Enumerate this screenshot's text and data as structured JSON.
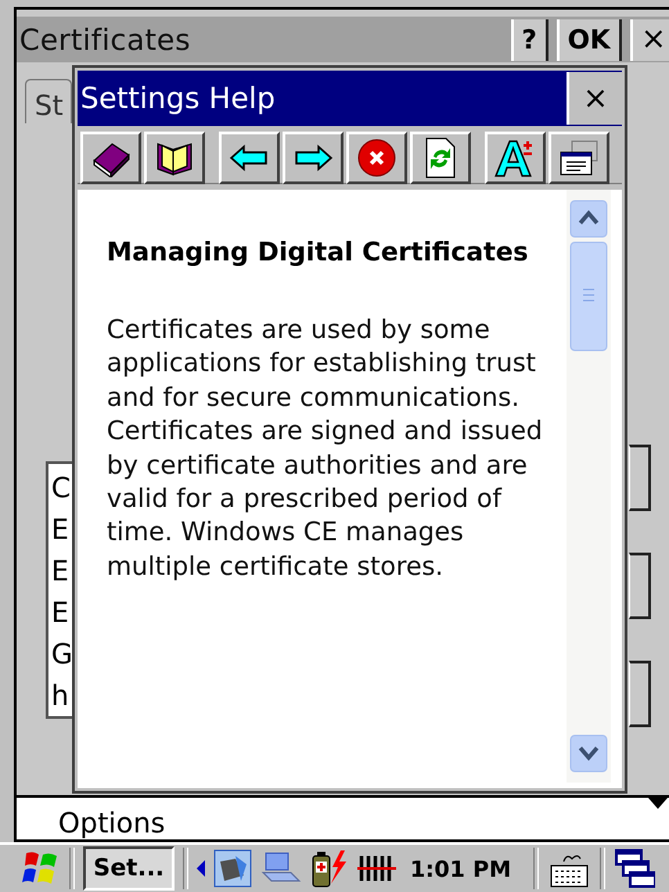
{
  "window": {
    "title": "Certificates",
    "buttons": [
      {
        "kind": "help",
        "label": "?"
      },
      {
        "kind": "ok",
        "label": "OK"
      },
      {
        "kind": "close",
        "label": "×"
      }
    ]
  },
  "tab": {
    "label": "St"
  },
  "list": {
    "items": [
      "C",
      "E",
      "E",
      "E",
      "G",
      "h"
    ]
  },
  "options": {
    "label": "Options"
  },
  "help": {
    "title": "Settings Help",
    "close": "×",
    "toolbar": [
      {
        "kind": "contents"
      },
      {
        "kind": "index"
      },
      {
        "kind": "gap"
      },
      {
        "kind": "back"
      },
      {
        "kind": "forward"
      },
      {
        "kind": "stop"
      },
      {
        "kind": "refresh"
      },
      {
        "kind": "gap"
      },
      {
        "kind": "font"
      },
      {
        "kind": "window"
      }
    ],
    "heading": "Managing Digital Certificates",
    "paragraph": "Certificates are used by some applications for establishing trust and for secure communications. Certificates are signed and issued by certificate authorities and are valid for a prescribed period of time. Windows CE manages multiple certificate stores."
  },
  "taskbar": {
    "task": "Set...",
    "clock": "1:01 PM"
  }
}
